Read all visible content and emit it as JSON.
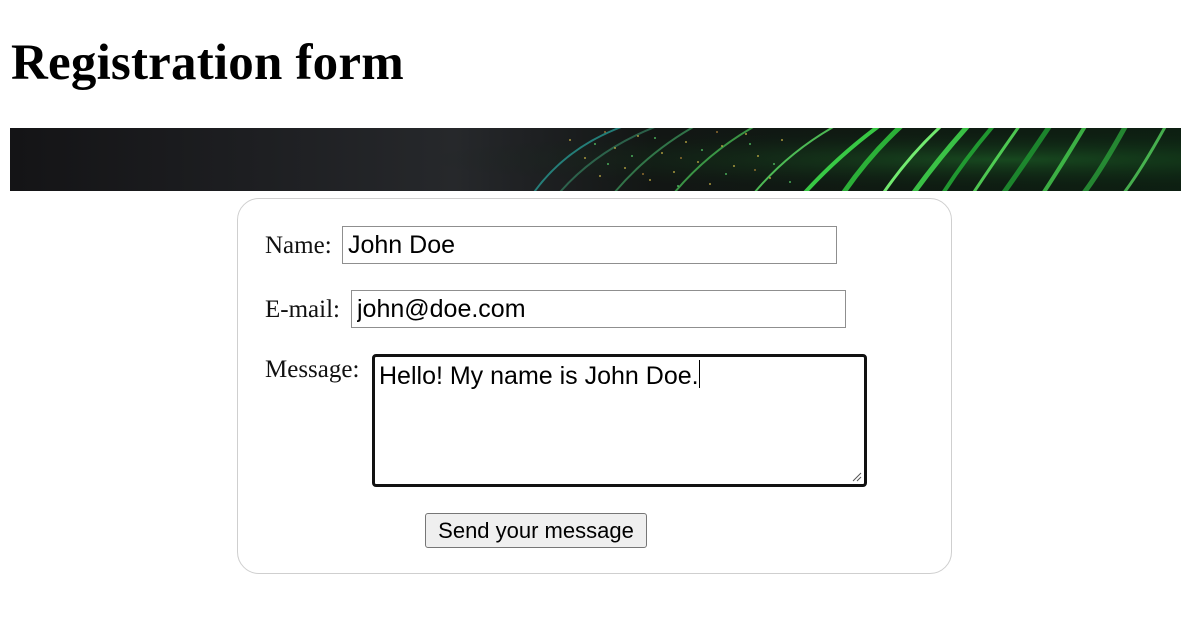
{
  "page": {
    "title": "Registration form"
  },
  "banner": {
    "image": "abstract-green-particle-rings-banner",
    "colors": {
      "dark": "#141416",
      "green": "#3ddc4a",
      "teal": "#2aa7a0"
    }
  },
  "form": {
    "name": {
      "label": "Name:",
      "value": "John Doe"
    },
    "email": {
      "label": "E-mail:",
      "value": "john@doe.com"
    },
    "message": {
      "label": "Message:",
      "value": "Hello! My name is John Doe."
    },
    "submit_label": "Send your message"
  }
}
